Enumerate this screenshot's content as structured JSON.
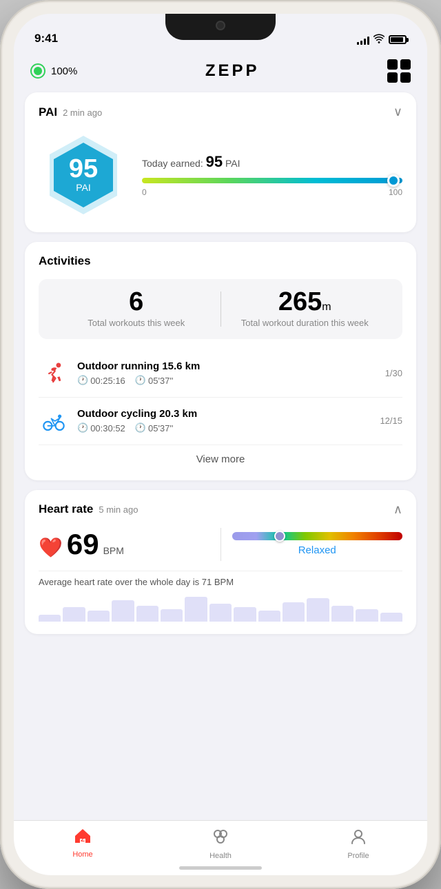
{
  "status_bar": {
    "time": "9:41",
    "battery_percent": "100%"
  },
  "header": {
    "watch_battery": "100%",
    "logo": "ZEPP",
    "grid_button_label": "apps"
  },
  "pai_card": {
    "title": "PAI",
    "time_ago": "2 min ago",
    "score": "95",
    "score_label": "PAI",
    "today_earned_label": "Today earned:",
    "today_earned_value": "95",
    "today_earned_unit": "PAI",
    "slider_min": "0",
    "slider_max": "100",
    "chevron": "∨"
  },
  "activities_card": {
    "title": "Activities",
    "total_workouts_count": "6",
    "total_workouts_label": "Total workouts this week",
    "total_duration_count": "265",
    "total_duration_unit": "m",
    "total_duration_label": "Total workout duration this week",
    "items": [
      {
        "type": "running",
        "name": "Outdoor running 15.6 km",
        "date": "1/30",
        "time": "00:25:16",
        "pace": "05'37''"
      },
      {
        "type": "cycling",
        "name": "Outdoor cycling 20.3 km",
        "date": "12/15",
        "time": "00:30:52",
        "pace": "05'37''"
      }
    ],
    "view_more_label": "View more"
  },
  "heart_rate_card": {
    "title": "Heart rate",
    "time_ago": "5 min ago",
    "bpm_value": "69",
    "bpm_unit": "BPM",
    "status": "Relaxed",
    "avg_text": "Average heart rate over the whole day is 71 BPM",
    "chevron": "∧"
  },
  "bottom_nav": {
    "items": [
      {
        "label": "Home",
        "active": true
      },
      {
        "label": "Health",
        "active": false
      },
      {
        "label": "Profile",
        "active": false
      }
    ]
  },
  "chart_bars": [
    4,
    8,
    6,
    12,
    9,
    7,
    14,
    10,
    8,
    6,
    11,
    13,
    9,
    7,
    5
  ]
}
